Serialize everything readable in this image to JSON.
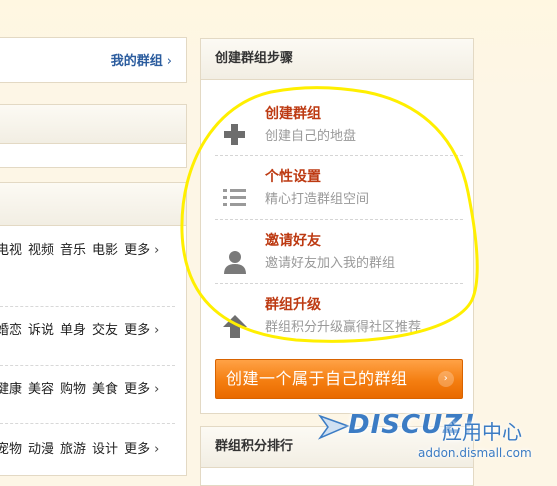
{
  "left": {
    "my_groups_label": "我的群组",
    "chevron": "›",
    "categories": [
      {
        "items": [
          "电视",
          "视频",
          "音乐",
          "电影"
        ],
        "more": "更多"
      },
      {
        "items": [
          "婚恋",
          "诉说",
          "单身",
          "交友"
        ],
        "more": "更多"
      },
      {
        "items": [
          "健康",
          "美容",
          "购物",
          "美食"
        ],
        "more": "更多"
      },
      {
        "items": [
          "宠物",
          "动漫",
          "旅游",
          "设计"
        ],
        "more": "更多"
      }
    ]
  },
  "panel": {
    "title": "创建群组步骤",
    "steps": [
      {
        "title": "创建群组",
        "desc": "创建自己的地盘",
        "icon": "plus-icon"
      },
      {
        "title": "个性设置",
        "desc": "精心打造群组空间",
        "icon": "list-icon"
      },
      {
        "title": "邀请好友",
        "desc": "邀请好友加入我的群组",
        "icon": "user-icon"
      },
      {
        "title": "群组升级",
        "desc": "群组积分升级赢得社区推荐",
        "icon": "arrow-up-icon"
      }
    ],
    "create_button": "创建一个属于自己的群组",
    "button_arrow": "›"
  },
  "panel2": {
    "title": "群组积分排行"
  },
  "watermark": {
    "brand": "DISCUZ!",
    "sub": "应用中心",
    "url": "addon.dismall.com"
  },
  "colors": {
    "accent_red": "#bd3a12",
    "link_blue": "#2b5c9e",
    "button_orange": "#f47e11",
    "annotation_yellow": "#ffef00"
  }
}
